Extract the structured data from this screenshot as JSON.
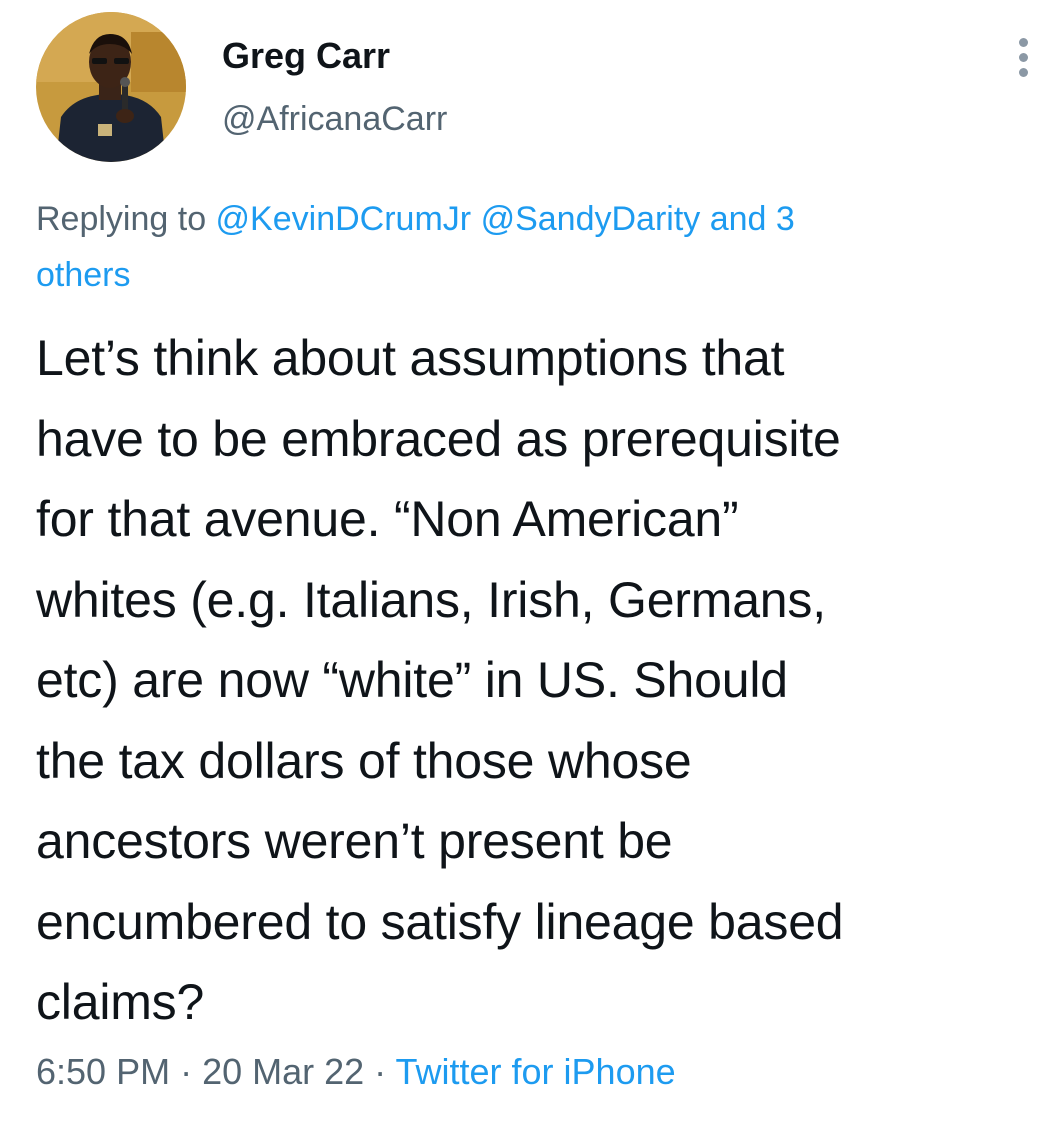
{
  "author": {
    "name": "Greg Carr",
    "handle": "@AfricanaCarr",
    "avatar_icon": "profile-photo"
  },
  "menu_icon": "more-vertical-icon",
  "reply_context": {
    "prefix": "Replying to ",
    "mention_1": "@KevinDCrumJr",
    "mention_2": "@SandyDarity",
    "others_link_part1": "and 3",
    "others_link_part2": "others"
  },
  "tweet": {
    "lines": [
      "Let’s think about assumptions that",
      "have to be embraced as prerequisite",
      "for that avenue. “Non American”",
      "whites (e.g. Italians, Irish, Germans,",
      "etc) are now “white” in US. Should",
      "the tax dollars of those whose",
      "ancestors weren’t present be",
      "encumbered to satisfy lineage based",
      "claims?"
    ]
  },
  "meta": {
    "time": "6:50 PM",
    "separator": " · ",
    "date": "20 Mar 22",
    "source": "Twitter for iPhone"
  },
  "colors": {
    "text": "#0f1419",
    "secondary": "#536471",
    "link": "#1d9bf0"
  }
}
